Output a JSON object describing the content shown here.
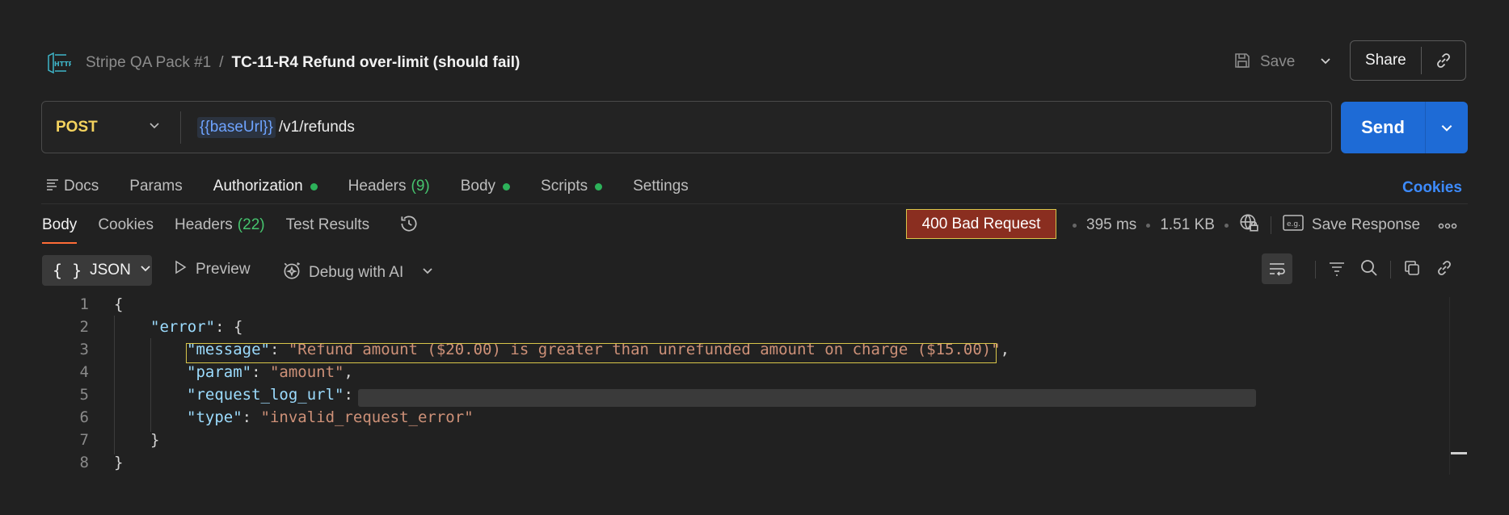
{
  "header": {
    "collection": "Stripe QA Pack #1",
    "separator": "/",
    "request_title": "TC-11-R4 Refund over-limit (should fail)",
    "save_label": "Save",
    "share_label": "Share"
  },
  "request": {
    "method": "POST",
    "url_variable": "{{baseUrl}}",
    "url_path": "/v1/refunds",
    "send_label": "Send"
  },
  "request_tabs": [
    {
      "label": "Docs"
    },
    {
      "label": "Params"
    },
    {
      "label": "Authorization"
    },
    {
      "label": "Headers",
      "count": "(9)"
    },
    {
      "label": "Body"
    },
    {
      "label": "Scripts"
    },
    {
      "label": "Settings"
    }
  ],
  "cookies_link": "Cookies",
  "response_tabs": [
    {
      "label": "Body"
    },
    {
      "label": "Cookies"
    },
    {
      "label": "Headers",
      "count": "(22)"
    },
    {
      "label": "Test Results"
    }
  ],
  "response": {
    "status": "400 Bad Request",
    "time": "395 ms",
    "size": "1.51 KB",
    "save_response": "Save Response"
  },
  "body_toolbar": {
    "format": "JSON",
    "preview": "Preview",
    "debug": "Debug with AI"
  },
  "code": {
    "line_numbers": [
      "1",
      "2",
      "3",
      "4",
      "5",
      "6",
      "7",
      "8"
    ],
    "open_brace": "{",
    "error_key": "\"error\"",
    "error_after": ": {",
    "message_key": "\"message\"",
    "message_value": "\"Refund amount ($20.00) is greater than unrefunded amount on charge ($15.00)\"",
    "param_key": "\"param\"",
    "param_value": "\"amount\"",
    "log_key": "\"request_log_url\"",
    "type_key": "\"type\"",
    "type_value": "\"invalid_request_error\"",
    "inner_close": "}",
    "outer_close": "}",
    "colon": ": ",
    "comma": ","
  },
  "colors": {
    "accent_blue": "#1e6bd6",
    "method_yellow": "#f4d35e",
    "status_red": "#8a2e20",
    "dot_green": "#2db25a",
    "tab_underline": "#ff6c37"
  }
}
